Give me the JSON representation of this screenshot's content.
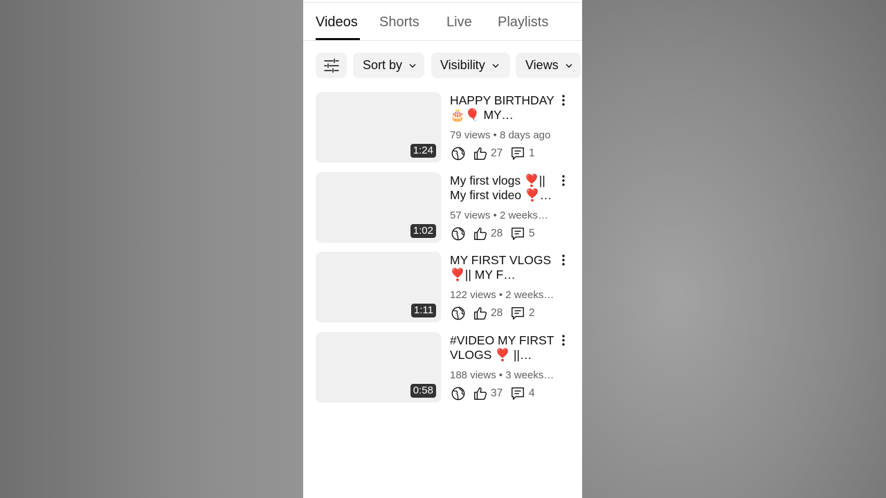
{
  "tabs": [
    {
      "label": "Videos",
      "active": true
    },
    {
      "label": "Shorts",
      "active": false
    },
    {
      "label": "Live",
      "active": false
    },
    {
      "label": "Playlists",
      "active": false
    }
  ],
  "filters": {
    "filter_icon": "sliders-icon",
    "chips": [
      "Sort by",
      "Visibility",
      "Views"
    ]
  },
  "videos": [
    {
      "title": "HAPPY BIRTHDAY 🎂🎈 MY FRIEND…",
      "duration": "1:24",
      "views": "79 views",
      "age": "8 days ago",
      "visibility_icon": "globe-icon",
      "likes": "27",
      "comments": "1"
    },
    {
      "title": "My first vlogs ❣️|| My first video ❣️…",
      "duration": "1:02",
      "views": "57 views",
      "age": "2 weeks…",
      "visibility_icon": "globe-icon",
      "likes": "28",
      "comments": "5"
    },
    {
      "title": "MY FIRST VLOGS ❣️|| MY F…",
      "duration": "1:11",
      "views": "122 views",
      "age": "2 weeks…",
      "visibility_icon": "globe-icon",
      "likes": "28",
      "comments": "2"
    },
    {
      "title": "#VIDEO MY FIRST VLOGS ❣️ || onle…",
      "duration": "0:58",
      "views": "188 views",
      "age": "3 weeks…",
      "visibility_icon": "globe-icon",
      "likes": "37",
      "comments": "4"
    }
  ],
  "colors": {
    "accent_text": "#0f0f0f",
    "secondary_text": "#606060",
    "chip_bg": "#f2f2f2",
    "thumb_bg": "#f0f0f0",
    "duration_bg": "#333333"
  }
}
